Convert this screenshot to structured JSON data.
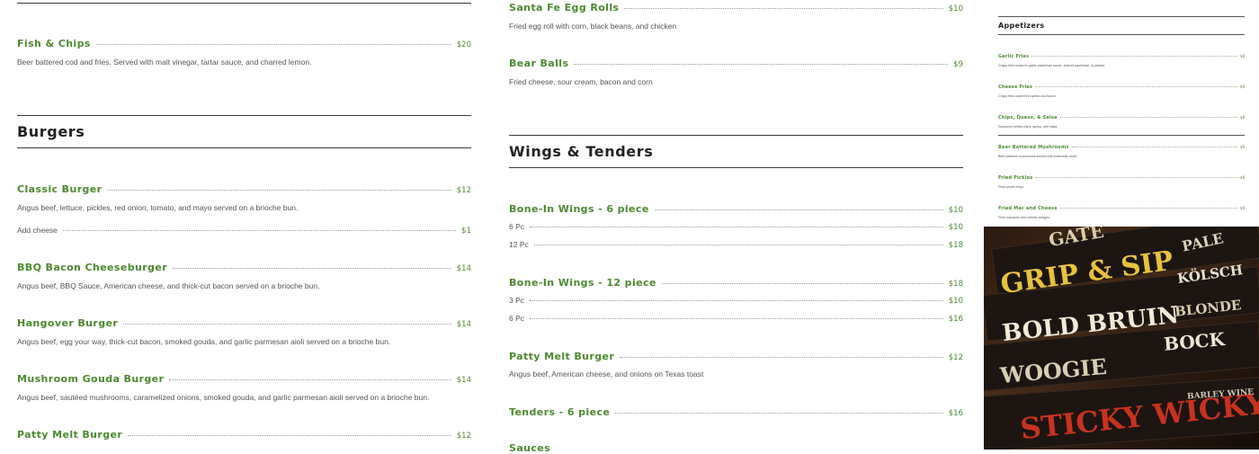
{
  "col1": {
    "fish_chips": {
      "name": "Fish & Chips",
      "price": "$20",
      "desc": "Beer battered cod and fries. Served with malt vinegar, tartar sauce, and charred lemon."
    },
    "burgers_title": "Burgers",
    "classic": {
      "name": "Classic Burger",
      "price": "$12",
      "desc": "Angus beef, lettuce, pickles, red onion, tomato, and mayo served on a brioche bun."
    },
    "add_cheese": {
      "name": "Add cheese",
      "price": "$1"
    },
    "bbq": {
      "name": "BBQ Bacon Cheeseburger",
      "price": "$14",
      "desc": "Angus beef, BBQ Sauce, American cheese, and thick-cut bacon served on a brioche bun."
    },
    "hangover": {
      "name": "Hangover Burger",
      "price": "$14",
      "desc": "Angus beef, egg your way, thick-cut bacon, smoked gouda, and garlic parmesan aioli served on a brioche bun."
    },
    "mushroom": {
      "name": "Mushroom Gouda Burger",
      "price": "$14",
      "desc": "Angus beef, sautéed mushrooms, caramelized onions, smoked gouda, and garlic parmesan aioli served on a brioche bun."
    },
    "patty": {
      "name": "Patty Melt Burger",
      "price": "$12"
    }
  },
  "col2": {
    "santa_fe": {
      "name": "Santa Fe Egg Rolls",
      "price": "$10",
      "desc": "Fried egg roll with corn, black beans, and chicken"
    },
    "bear_balls": {
      "name": "Bear Balls",
      "price": "$9",
      "desc": "Fried cheese, sour cream, bacon and corn"
    },
    "wings_title": "Wings & Tenders",
    "wings6": {
      "name": "Bone-In Wings - 6 piece",
      "price": "$10",
      "opts": [
        {
          "name": "6 Pc",
          "price": "$10"
        },
        {
          "name": "12 Pc",
          "price": "$18"
        }
      ]
    },
    "wings12": {
      "name": "Bone-In Wings - 12 piece",
      "price": "$18",
      "opts": [
        {
          "name": "3 Pc",
          "price": "$10"
        },
        {
          "name": "6 Pc",
          "price": "$16"
        }
      ]
    },
    "patty": {
      "name": "Patty Melt Burger",
      "price": "$12",
      "desc": "Angus beef, American cheese, and onions on Texas toast"
    },
    "tenders": {
      "name": "Tenders - 6 piece",
      "price": "$16"
    },
    "sauces_title": "Sauces"
  },
  "panel": {
    "title": "Appetizers",
    "items": [
      {
        "name": "Garlic Fries",
        "price": "$8",
        "desc": "Crispy fries tossed in garlic parmesan sauce, shaved parmesan, & parsley."
      },
      {
        "name": "Cheese Fries",
        "price": "$9",
        "desc": "Crispy fries covered in queso and bacon."
      },
      {
        "name": "Chips, Queso, & Salsa",
        "price": "$8",
        "desc": "Seasoned tortilla chips, queso, and salsa."
      },
      {
        "name": "Beer Battered Mushrooms",
        "price": "$9",
        "desc": "Beer battered mushrooms served with buttermilk ranch."
      },
      {
        "name": "Fried Pickles",
        "price": "$8",
        "desc": "Fried pickle chips."
      },
      {
        "name": "Fried Mac and Cheese",
        "price": "$9",
        "desc": "Fried macaroni and cheese wedges."
      }
    ]
  },
  "photo": {
    "words": [
      "GRIP & SIP",
      "BOLD BRUIN",
      "KÖLSCH",
      "BLONDE",
      "BOCK",
      "PALE",
      "GATE",
      "STICKY WICKY",
      "BARLEY WINE",
      "WOOGIE"
    ]
  }
}
